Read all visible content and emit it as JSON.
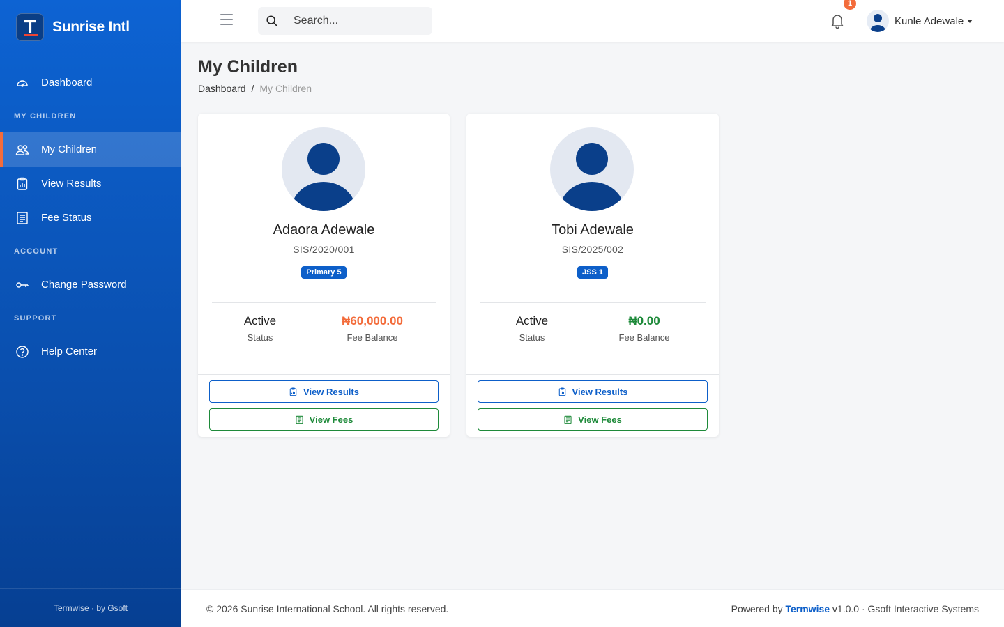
{
  "brand": {
    "name": "Sunrise Intl",
    "logo_letter": "T"
  },
  "sidebar": {
    "dashboard": "Dashboard",
    "sections": {
      "my_children": "MY CHILDREN",
      "account": "ACCOUNT",
      "support": "SUPPORT"
    },
    "items": {
      "my_children": "My Children",
      "view_results": "View Results",
      "fee_status": "Fee Status",
      "change_password": "Change Password",
      "help_center": "Help Center"
    },
    "footer": "Termwise · by Gsoft"
  },
  "topbar": {
    "search_placeholder": "Search...",
    "notification_count": "1",
    "user_name": "Kunle Adewale"
  },
  "page": {
    "title": "My Children",
    "breadcrumb": {
      "home": "Dashboard",
      "separator": "/",
      "current": "My Children"
    }
  },
  "children": [
    {
      "name": "Adaora Adewale",
      "student_id": "SIS/2020/001",
      "class": "Primary 5",
      "status": "Active",
      "status_label": "Status",
      "fee_balance": "₦60,000.00",
      "fee_balance_label": "Fee Balance",
      "view_results": "View Results",
      "view_fees": "View Fees"
    },
    {
      "name": "Tobi Adewale",
      "student_id": "SIS/2025/002",
      "class": "JSS 1",
      "status": "Active",
      "status_label": "Status",
      "fee_balance": "₦0.00",
      "fee_balance_label": "Fee Balance",
      "view_results": "View Results",
      "view_fees": "View Fees"
    }
  ],
  "footer": {
    "copyright": "© 2026 Sunrise International School. All rights reserved.",
    "powered_prefix": "Powered by",
    "powered_brand": "Termwise",
    "powered_suffix": "v1.0.0 · Gsoft Interactive Systems"
  },
  "colors": {
    "sidebar_primary": "#0d63d3",
    "accent": "#f36c3b",
    "primary_button": "#0d5fc9",
    "success": "#1e8a3a"
  }
}
